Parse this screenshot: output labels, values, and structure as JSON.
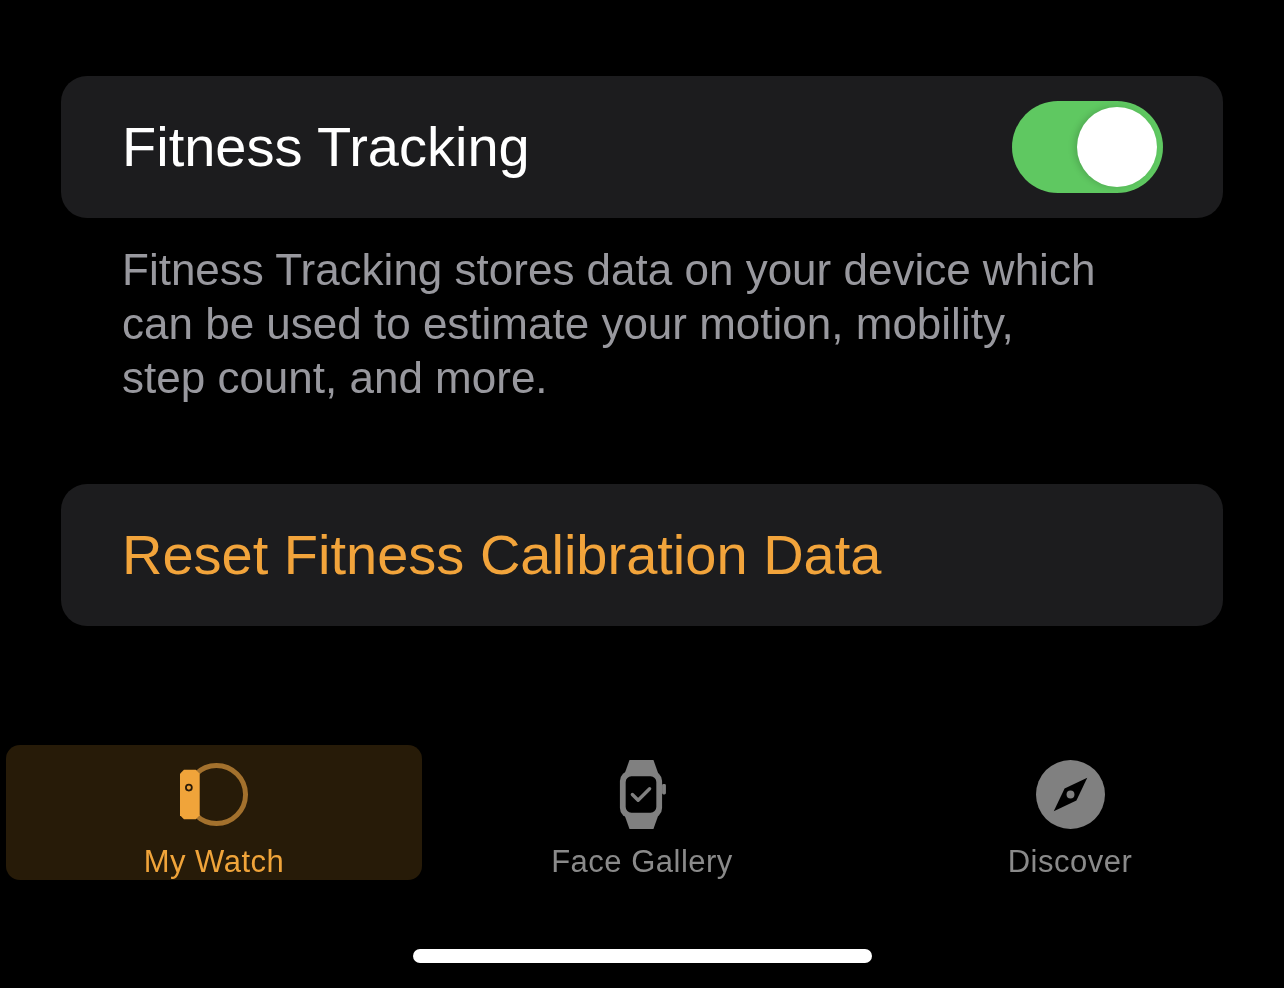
{
  "toggle_row": {
    "label": "Fitness Tracking",
    "on": true
  },
  "footer_text": "Fitness Tracking stores data on your device which can be used to estimate your motion, mobility, step count, and more.",
  "reset_row": {
    "label": "Reset Fitness Calibration Data"
  },
  "tab_bar": {
    "tabs": [
      {
        "label": "My Watch",
        "kind": "my-watch",
        "selected": true
      },
      {
        "label": "Face Gallery",
        "kind": "face-gallery",
        "selected": false
      },
      {
        "label": "Discover",
        "kind": "discover",
        "selected": false
      }
    ]
  }
}
